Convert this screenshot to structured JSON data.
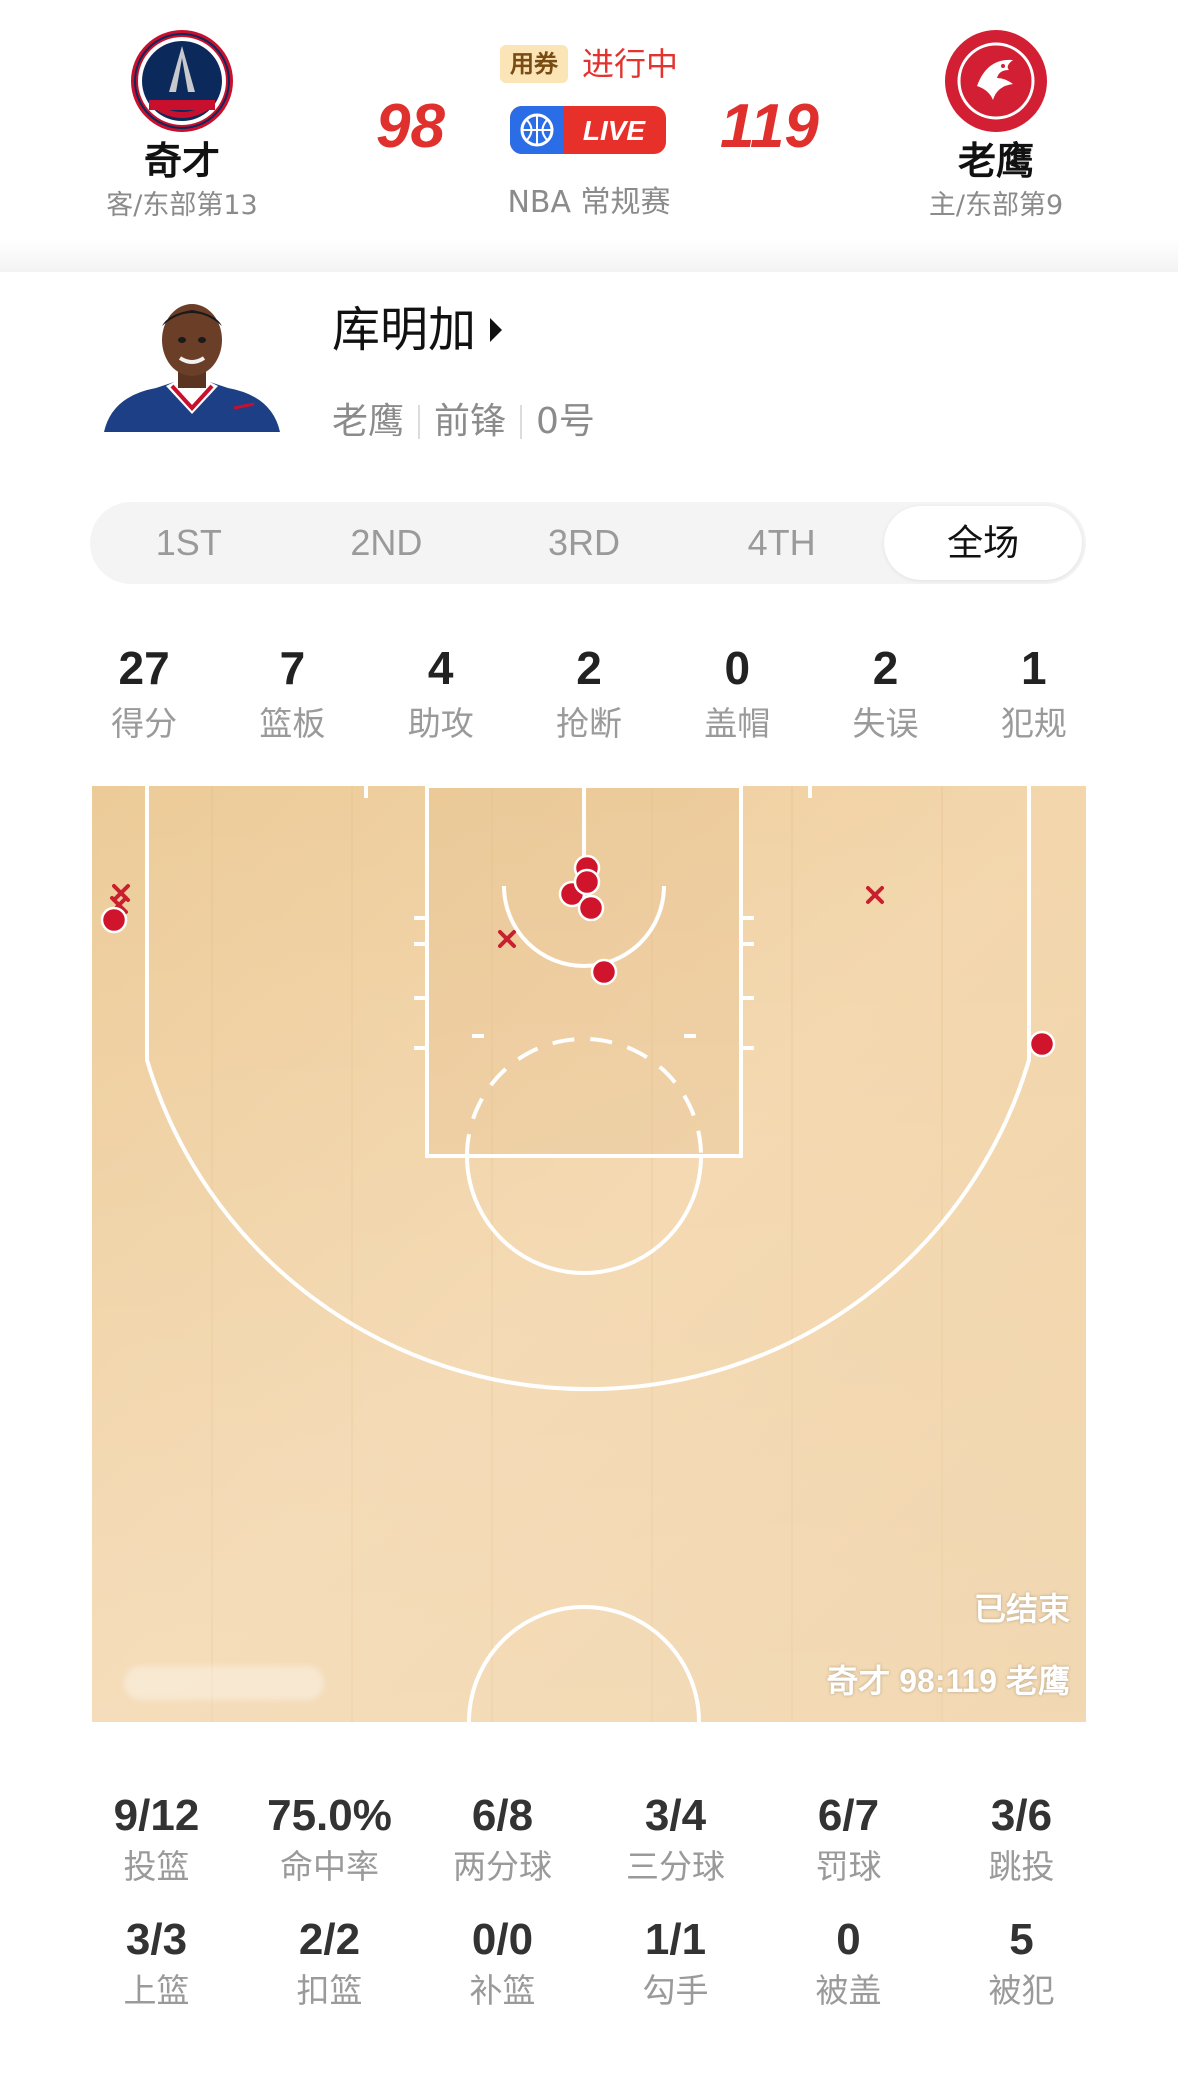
{
  "header": {
    "away": {
      "name": "奇才",
      "sub": "客/东部第13",
      "score": "98",
      "logo_text": "WASHINGTON WIZARDS"
    },
    "home": {
      "name": "老鹰",
      "sub": "主/东部第9",
      "score": "119",
      "logo_text": "ATLANTA HAWKS BASKETBALL"
    },
    "coupon": "用券",
    "status": "进行中",
    "live": "LIVE",
    "league": "NBA 常规赛"
  },
  "player": {
    "name": "库明加",
    "team": "老鹰",
    "position": "前锋",
    "number": "0号"
  },
  "tabs": [
    "1ST",
    "2ND",
    "3RD",
    "4TH",
    "全场"
  ],
  "active_tab": "全场",
  "main_stats": [
    {
      "value": "27",
      "label": "得分"
    },
    {
      "value": "7",
      "label": "篮板"
    },
    {
      "value": "4",
      "label": "助攻"
    },
    {
      "value": "2",
      "label": "抢断"
    },
    {
      "value": "0",
      "label": "盖帽"
    },
    {
      "value": "2",
      "label": "失误"
    },
    {
      "value": "1",
      "label": "犯规"
    }
  ],
  "court": {
    "watermark_status": "已结束",
    "watermark_score": "奇才 98:119 老鹰",
    "colors": {
      "made": "#d0142c",
      "missed": "#c8202e",
      "wood": "#f0cfa0",
      "lines": "#ffffff"
    }
  },
  "shooting_stats": [
    {
      "value": "9/12",
      "label": "投篮"
    },
    {
      "value": "75.0%",
      "label": "命中率"
    },
    {
      "value": "6/8",
      "label": "两分球"
    },
    {
      "value": "3/4",
      "label": "三分球"
    },
    {
      "value": "6/7",
      "label": "罚球"
    },
    {
      "value": "3/6",
      "label": "跳投"
    },
    {
      "value": "3/3",
      "label": "上篮"
    },
    {
      "value": "2/2",
      "label": "扣篮"
    },
    {
      "value": "0/0",
      "label": "补篮"
    },
    {
      "value": "1/1",
      "label": "勾手"
    },
    {
      "value": "0",
      "label": "被盖"
    },
    {
      "value": "5",
      "label": "被犯"
    }
  ]
}
